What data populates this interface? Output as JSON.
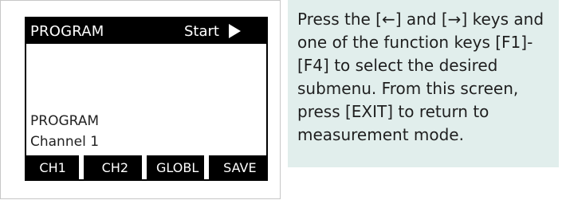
{
  "screen": {
    "title_left": "PROGRAM",
    "title_right": "Start",
    "play_icon": "play-triangle",
    "line1": "PROGRAM",
    "line2": "Channel 1",
    "softkeys": [
      "CH1",
      "CH2",
      "GLOBL",
      "SAVE"
    ]
  },
  "instruction": {
    "text": "Press the [←] and [→] keys and one of the function keys [F1]-[F4] to select the desired submenu. From this screen, press [EXIT] to return to measurement mode."
  },
  "colors": {
    "screen_bg": "#ffffff",
    "title_bar": "#000000",
    "panel_bg": "#e1eeec"
  }
}
